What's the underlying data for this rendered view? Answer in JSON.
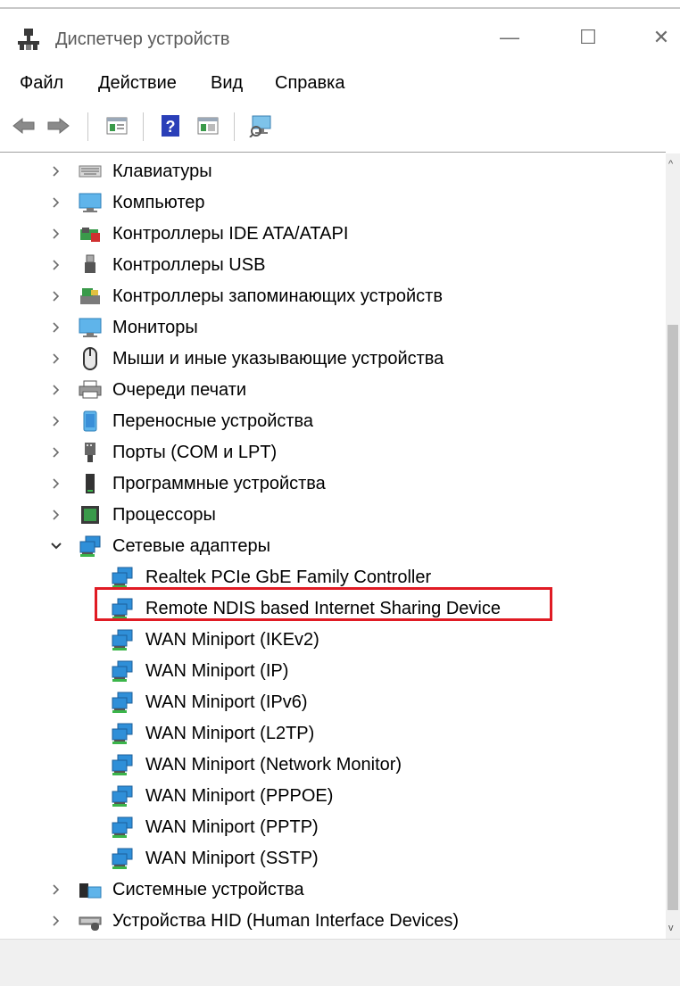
{
  "window": {
    "title": "Диспетчер устройств",
    "minimize_glyph": "—",
    "maximize_glyph": "☐",
    "close_glyph": "✕"
  },
  "menu": {
    "file": "Файл",
    "action": "Действие",
    "view": "Вид",
    "help": "Справка"
  },
  "toolbar": {
    "icons": [
      "back-arrow-icon",
      "forward-arrow-icon",
      "properties-icon",
      "help-icon",
      "update-driver-icon",
      "scan-hardware-icon"
    ]
  },
  "tree": {
    "categories_top": [
      {
        "label": "Клавиатуры",
        "icon": "keyboard-icon"
      },
      {
        "label": "Компьютер",
        "icon": "computer-icon"
      },
      {
        "label": "Контроллеры IDE ATA/ATAPI",
        "icon": "ide-controller-icon"
      },
      {
        "label": "Контроллеры USB",
        "icon": "usb-icon"
      },
      {
        "label": "Контроллеры запоминающих устройств",
        "icon": "storage-controller-icon"
      },
      {
        "label": "Мониторы",
        "icon": "monitor-icon"
      },
      {
        "label": "Мыши и иные указывающие устройства",
        "icon": "mouse-icon"
      },
      {
        "label": "Очереди печати",
        "icon": "printer-icon"
      },
      {
        "label": "Переносные устройства",
        "icon": "portable-device-icon"
      },
      {
        "label": "Порты (COM и LPT)",
        "icon": "port-icon"
      },
      {
        "label": "Программные устройства",
        "icon": "software-device-icon"
      },
      {
        "label": "Процессоры",
        "icon": "processor-icon"
      }
    ],
    "network": {
      "label": "Сетевые адаптеры",
      "expanded": true,
      "children": [
        "Realtek PCIe GbE Family Controller",
        "Remote NDIS based Internet Sharing Device",
        "WAN Miniport (IKEv2)",
        "WAN Miniport (IP)",
        "WAN Miniport (IPv6)",
        "WAN Miniport (L2TP)",
        "WAN Miniport (Network Monitor)",
        "WAN Miniport (PPPOE)",
        "WAN Miniport (PPTP)",
        "WAN Miniport (SSTP)"
      ],
      "highlighted_child": "Remote NDIS based Internet Sharing Device"
    },
    "categories_bottom": [
      {
        "label": "Системные устройства",
        "icon": "system-devices-icon"
      },
      {
        "label": "Устройства HID (Human Interface Devices)",
        "icon": "hid-icon"
      }
    ]
  },
  "colors": {
    "highlight_border": "#e01b24",
    "network_icon_blue": "#2f8fd8",
    "network_icon_green": "#3bb54a"
  }
}
